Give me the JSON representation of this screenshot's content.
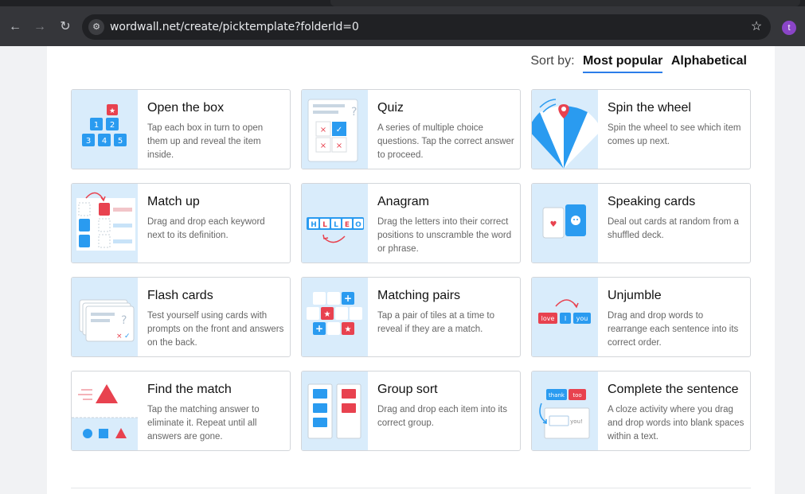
{
  "browser": {
    "url": "wordwall.net/create/picktemplate?folderId=0",
    "back_icon": "arrow-left-icon",
    "forward_icon": "arrow-right-icon",
    "reload_icon": "reload-icon",
    "avatar_letter": "t"
  },
  "sort": {
    "label": "Sort by:",
    "active": "Most popular",
    "other": "Alphabetical"
  },
  "templates": [
    {
      "title": "Open the box",
      "desc": "Tap each box in turn to open them up and reveal the item inside."
    },
    {
      "title": "Quiz",
      "desc": "A series of multiple choice questions. Tap the correct answer to proceed."
    },
    {
      "title": "Spin the wheel",
      "desc": "Spin the wheel to see which item comes up next."
    },
    {
      "title": "Match up",
      "desc": "Drag and drop each keyword next to its definition."
    },
    {
      "title": "Anagram",
      "desc": "Drag the letters into their correct positions to unscramble the word or phrase."
    },
    {
      "title": "Speaking cards",
      "desc": "Deal out cards at random from a shuffled deck."
    },
    {
      "title": "Flash cards",
      "desc": "Test yourself using cards with prompts on the front and answers on the back."
    },
    {
      "title": "Matching pairs",
      "desc": "Tap a pair of tiles at a time to reveal if they are a match."
    },
    {
      "title": "Unjumble",
      "desc": "Drag and drop words to rearrange each sentence into its correct order."
    },
    {
      "title": "Find the match",
      "desc": "Tap the matching answer to eliminate it. Repeat until all answers are gone."
    },
    {
      "title": "Group sort",
      "desc": "Drag and drop each item into its correct group."
    },
    {
      "title": "Complete the sentence",
      "desc": "A cloze activity where you drag and drop words into blank spaces within a text."
    }
  ],
  "thumb_text": {
    "open_box": [
      "1",
      "2",
      "3",
      "4",
      "5"
    ],
    "anagram": [
      "H",
      "L",
      "L",
      "E",
      "O"
    ],
    "unjumble": [
      "love",
      "I",
      "you"
    ],
    "complete": [
      "thank",
      "too",
      "you!"
    ]
  }
}
